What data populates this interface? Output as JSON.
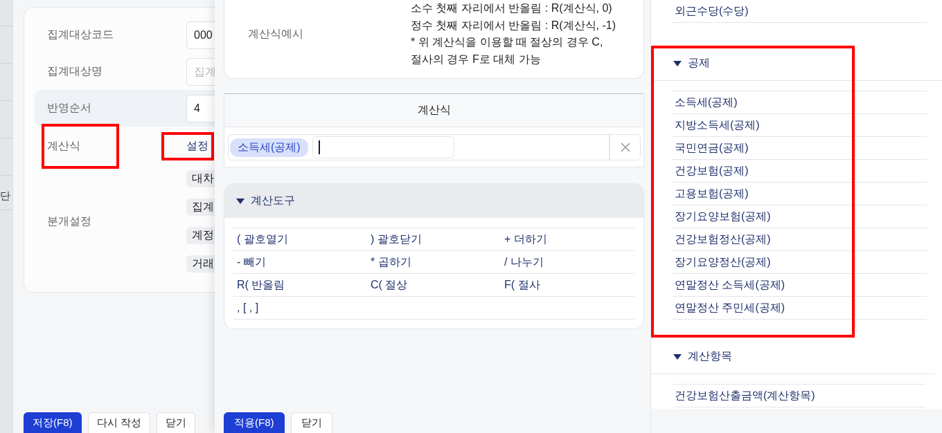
{
  "background_table": {
    "cell_text": "단"
  },
  "form": {
    "fields": [
      {
        "kind": "input",
        "label": "집계대상코드",
        "value": "000",
        "hovered": false,
        "annotated": false
      },
      {
        "kind": "input",
        "label": "집계대상명",
        "placeholder": "집계",
        "hovered": false,
        "annotated": false
      },
      {
        "kind": "input",
        "label": "반영순서",
        "value": "4",
        "hovered": true,
        "annotated": false
      },
      {
        "kind": "link",
        "label": "계산식",
        "link_text": "설정",
        "hovered": false,
        "annotated": true
      },
      {
        "kind": "tags",
        "label": "분개설정",
        "tags": [
          "대차",
          "집계",
          "계정",
          "거래"
        ],
        "hovered": false,
        "annotated": false
      }
    ],
    "buttons": [
      {
        "label": "저장(F8)",
        "primary": true
      },
      {
        "label": "다시 작성",
        "primary": false
      },
      {
        "label": "닫기",
        "primary": false
      }
    ]
  },
  "drawer": {
    "example": {
      "label": "계산식예시",
      "lines": [
        "소수 첫째 자리에서 반올림 : R(계산식, 0)",
        "정수 첫째 자리에서 반올림 : R(계산식, -1)",
        "* 위 계산식을 이용할 때 절상의 경우 C, 절사의 경우 F로 대체 가능"
      ]
    },
    "formula": {
      "title": "계산식",
      "tokens": [
        "소득세(공제)"
      ]
    },
    "tools": {
      "title": "계산도구",
      "expanded": true,
      "items": [
        "( 괄호열기",
        ") 괄호닫기",
        "+ 더하기",
        "- 빼기",
        "* 곱하기",
        "/ 나누기",
        "R( 반올림",
        "C( 절상",
        "F( 절사",
        ", [ , ]"
      ]
    },
    "buttons": [
      {
        "label": "적용(F8)",
        "primary": true
      },
      {
        "label": "닫기",
        "primary": false
      }
    ]
  },
  "item_panel": {
    "top_items": [
      "외근수당(수당)"
    ],
    "sections": [
      {
        "title": "공제",
        "expanded": true,
        "annotated": true,
        "items": [
          "소득세(공제)",
          "지방소득세(공제)",
          "국민연금(공제)",
          "건강보험(공제)",
          "고용보험(공제)",
          "장기요양보험(공제)",
          "건강보험정산(공제)",
          "장기요양정산(공제)",
          "연말정산 소득세(공제)",
          "연말정산 주민세(공제)"
        ]
      },
      {
        "title": "계산항목",
        "expanded": true,
        "annotated": false,
        "items": [
          "건강보험산출금액(계산항목)"
        ]
      }
    ]
  }
}
